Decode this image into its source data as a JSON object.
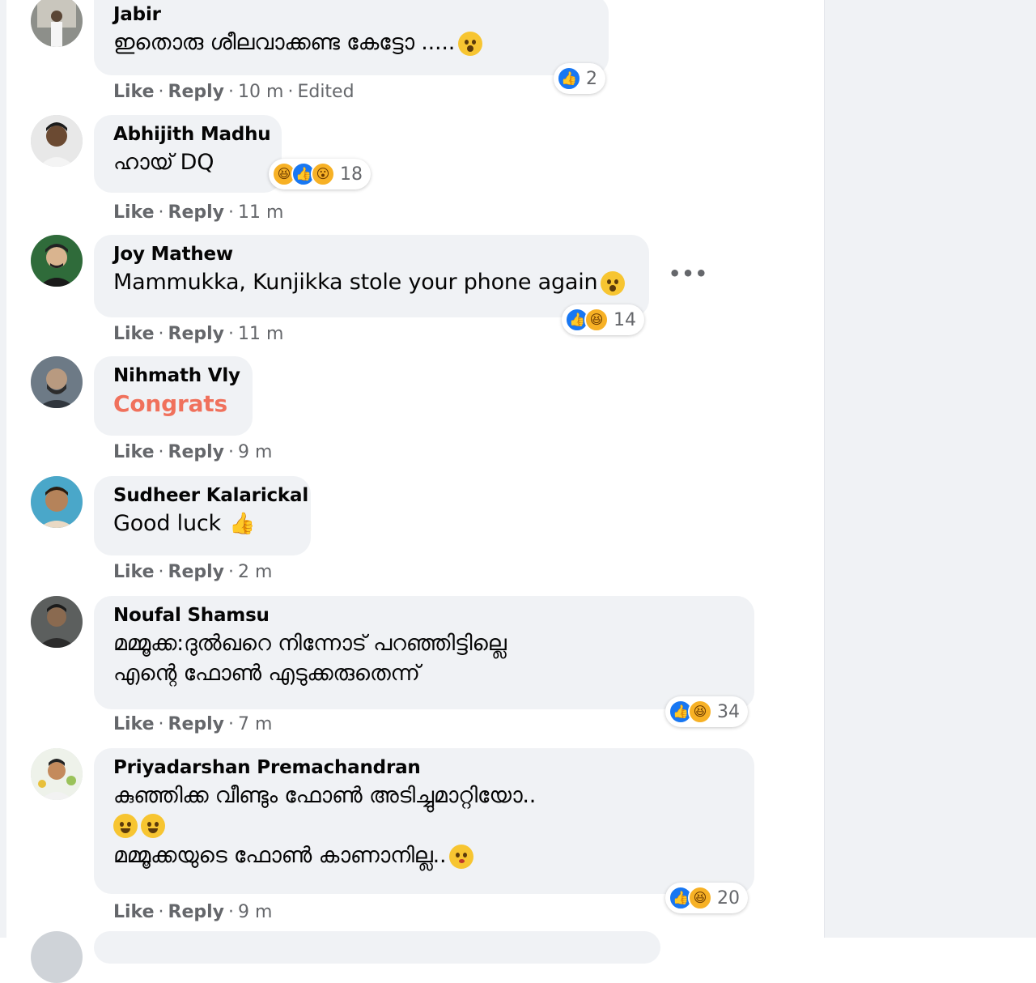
{
  "actions": {
    "like": "Like",
    "reply": "Reply",
    "separator": "·"
  },
  "comments": [
    {
      "author": "Jabir",
      "lines": [
        "ഇതൊരു ശീലവാക്കണ്ട കേട്ടോ ....."
      ],
      "time": "10 m",
      "edited": "Edited",
      "reaction_count": "2",
      "reactions": [
        "like-icon"
      ]
    },
    {
      "author": "Abhijith Madhu",
      "lines": [
        "ഹായ് DQ"
      ],
      "time": "11 m",
      "reaction_count": "18",
      "reactions": [
        "haha-icon",
        "like-icon",
        "wow-icon"
      ]
    },
    {
      "author": "Joy Mathew",
      "lines": [
        "Mammukka, Kunjikka stole your phone again"
      ],
      "time": "11 m",
      "reaction_count": "14",
      "reactions": [
        "like-icon",
        "haha-icon"
      ],
      "more": "•••"
    },
    {
      "author": "Nihmath Vly",
      "lines": [
        "Congrats"
      ],
      "time": "9 m"
    },
    {
      "author": "Sudheer Kalarickal",
      "lines": [
        "Good luck"
      ],
      "time": "2 m"
    },
    {
      "author": "Noufal Shamsu",
      "lines": [
        "മമ്മൂക്ക:ദുൽഖറെ നിന്നോട് പറഞ്ഞിട്ടില്ലെ",
        "എന്റെ ഫോൺ എടുക്കരുതെന്ന്"
      ],
      "time": "7 m",
      "reaction_count": "34",
      "reactions": [
        "like-icon",
        "haha-icon"
      ]
    },
    {
      "author": "Priyadarshan Premachandran",
      "lines": [
        "കുഞ്ഞിക്ക വീണ്ടും ഫോൺ അടിച്ചുമാറ്റിയോ..",
        "",
        "മമ്മൂക്കയുടെ ഫോൺ കാണാനില്ല.."
      ],
      "time": "9 m",
      "reaction_count": "20",
      "reactions": [
        "like-icon",
        "haha-icon"
      ]
    }
  ],
  "colors": {
    "bubble": "#f0f2f5",
    "meta": "#65676b",
    "congrats": "#f0715c",
    "like": "#1877f2",
    "haha": "#f7b125"
  }
}
